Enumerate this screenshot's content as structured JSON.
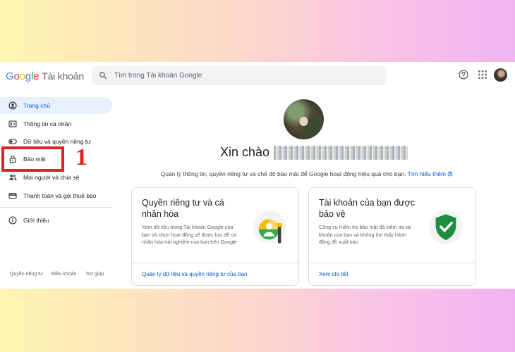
{
  "brand": {
    "letters": [
      {
        "ch": "G",
        "color": "#4285f4"
      },
      {
        "ch": "o",
        "color": "#ea4335"
      },
      {
        "ch": "o",
        "color": "#fbbc05"
      },
      {
        "ch": "g",
        "color": "#4285f4"
      },
      {
        "ch": "l",
        "color": "#34a853"
      },
      {
        "ch": "e",
        "color": "#ea4335"
      }
    ],
    "product": "Tài khoản"
  },
  "search": {
    "placeholder": "Tìm trong Tài khoản Google",
    "value": ""
  },
  "header_icons": [
    "help-icon",
    "apps-grid-icon",
    "account-avatar"
  ],
  "sidebar": {
    "items": [
      {
        "label": "Trang chủ",
        "icon": "home-person-icon",
        "active": true
      },
      {
        "label": "Thông tin cá nhân",
        "icon": "id-card-icon",
        "active": false
      },
      {
        "label": "Dữ liệu và quyền riêng tư",
        "icon": "toggle-icon",
        "active": false
      },
      {
        "label": "Bảo mật",
        "icon": "lock-icon",
        "active": false
      },
      {
        "label": "Mọi người và chia sẻ",
        "icon": "people-icon",
        "active": false
      },
      {
        "label": "Thanh toán và gói thuê bao",
        "icon": "credit-card-icon",
        "active": false
      },
      {
        "label": "Giới thiệu",
        "icon": "info-icon",
        "active": false
      }
    ],
    "footer": [
      "Quyền riêng tư",
      "Điều khoản",
      "Trợ giúp"
    ]
  },
  "annotation": {
    "number": "1",
    "color": "#e31e24"
  },
  "main": {
    "greeting": "Xin chào",
    "subtitle": "Quản lý thông tin, quyền riêng tư và chế độ bảo mật để Google hoạt động hiệu quả cho bạn.",
    "learn_more": "Tìm hiểu thêm",
    "cards": [
      {
        "title": "Quyền riêng tư và cá nhân hóa",
        "description": "Xem dữ liệu trong Tài khoản Google của bạn và chọn hoạt động sẽ được lưu để cá nhân hóa trải nghiệm của bạn trên Google",
        "link": "Quản lý dữ liệu và quyền riêng tư của bạn",
        "icon": "privacy-illustration-icon"
      },
      {
        "title": "Tài khoản của bạn được bảo vệ",
        "description": "Công cụ Kiểm tra bảo mật đã kiểm tra tài khoản của bạn và không tìm thấy hành động đề xuất nào",
        "link": "Xem chi tiết",
        "icon": "shield-check-icon"
      }
    ]
  },
  "colors": {
    "accent": "#0b57d0",
    "active_bg": "#e8f0fe",
    "shield_green": "#1e8e3e"
  }
}
